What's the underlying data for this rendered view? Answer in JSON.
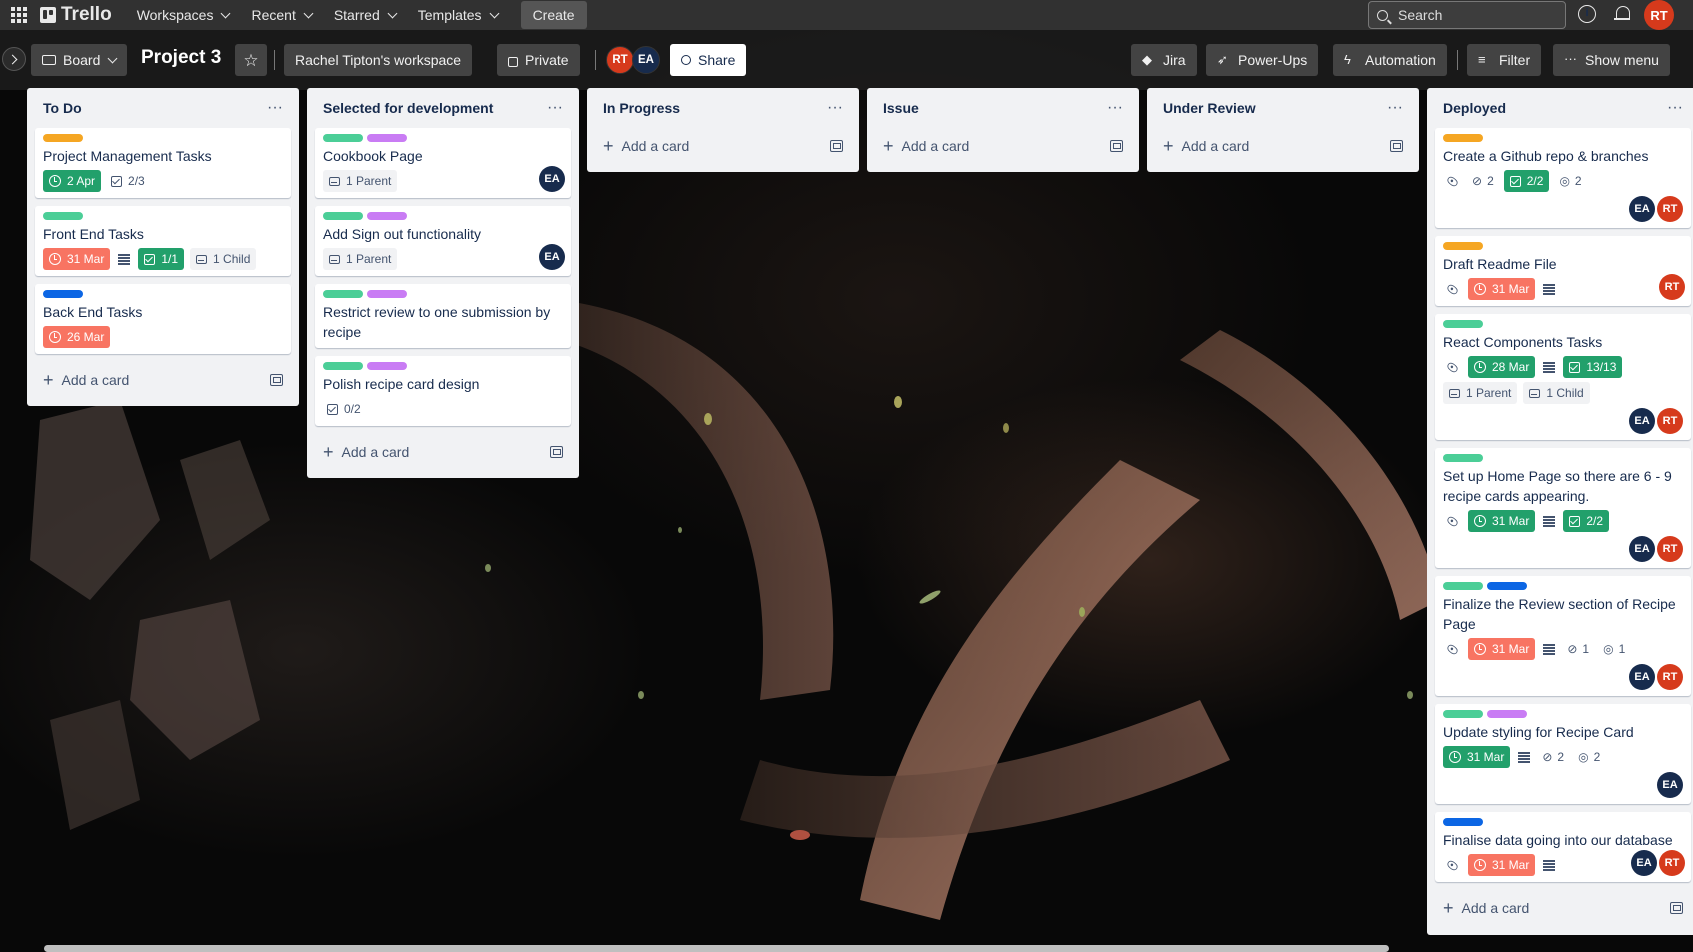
{
  "topnav": {
    "brand": "Trello",
    "menus": [
      "Workspaces",
      "Recent",
      "Starred",
      "Templates"
    ],
    "create_label": "Create",
    "search_placeholder": "Search",
    "user_initials": "RT"
  },
  "board": {
    "view_label": "Board",
    "title": "Project 3",
    "workspace_label": "Rachel Tipton's workspace",
    "visibility_label": "Private",
    "members": [
      "RT",
      "EA"
    ],
    "share_label": "Share",
    "jira_label": "Jira",
    "powerups_label": "Power-Ups",
    "automation_label": "Automation",
    "filter_label": "Filter",
    "show_menu_label": "Show menu"
  },
  "colors": {
    "orange": "#f5a623",
    "green": "#4bce97",
    "purple": "#c97cf4",
    "blue": "#0c66e4",
    "due_green": "#22a06b",
    "due_red": "#f87462",
    "avatar_rt": "#d63a1c",
    "avatar_ea": "#172b4d"
  },
  "add_card_label": "Add a card",
  "lists": [
    {
      "title": "To Do",
      "cards": [
        {
          "labels": [
            "orange"
          ],
          "title": "Project Management Tasks",
          "due": {
            "text": "2 Apr",
            "state": "green"
          },
          "checklist": {
            "text": "2/3",
            "state": "plain"
          }
        },
        {
          "labels": [
            "green"
          ],
          "title": "Front End Tasks",
          "due": {
            "text": "31 Mar",
            "state": "red"
          },
          "description": true,
          "checklist": {
            "text": "1/1",
            "state": "green"
          },
          "relation": "1 Child"
        },
        {
          "labels": [
            "blue"
          ],
          "title": "Back End Tasks",
          "due": {
            "text": "26 Mar",
            "state": "red"
          }
        }
      ]
    },
    {
      "title": "Selected for development",
      "cards": [
        {
          "labels": [
            "green",
            "purple"
          ],
          "title": "Cookbook Page",
          "relation": "1 Parent",
          "members": [
            "EA"
          ]
        },
        {
          "labels": [
            "green",
            "purple"
          ],
          "title": "Add Sign out functionality",
          "relation": "1 Parent",
          "members": [
            "EA"
          ]
        },
        {
          "labels": [
            "green",
            "purple"
          ],
          "title": "Restrict review to one submission by recipe"
        },
        {
          "labels": [
            "green",
            "purple"
          ],
          "title": "Polish recipe card design",
          "checklist": {
            "text": "0/2",
            "state": "plain"
          }
        }
      ]
    },
    {
      "title": "In Progress",
      "cards": []
    },
    {
      "title": "Issue",
      "cards": []
    },
    {
      "title": "Under Review",
      "cards": []
    },
    {
      "title": "Deployed",
      "cards": [
        {
          "labels": [
            "orange"
          ],
          "title": "Create a Github repo & branches",
          "watch": true,
          "attachments": "2",
          "checklist": {
            "text": "2/2",
            "state": "green"
          },
          "github": "2",
          "members": [
            "EA",
            "RT"
          ]
        },
        {
          "labels": [
            "orange"
          ],
          "title": "Draft Readme File",
          "watch": true,
          "due": {
            "text": "31 Mar",
            "state": "red"
          },
          "description": true,
          "members": [
            "RT"
          ]
        },
        {
          "labels": [
            "green"
          ],
          "title": "React Components Tasks",
          "watch": true,
          "due": {
            "text": "28 Mar",
            "state": "green"
          },
          "description": true,
          "checklist": {
            "text": "13/13",
            "state": "green"
          },
          "relation": "1 Parent",
          "relation2": "1 Child",
          "members": [
            "EA",
            "RT"
          ]
        },
        {
          "labels": [
            "green"
          ],
          "title": "Set up Home Page so there are 6 - 9 recipe cards appearing.",
          "watch": true,
          "due": {
            "text": "31 Mar",
            "state": "green"
          },
          "description": true,
          "checklist": {
            "text": "2/2",
            "state": "green"
          },
          "members": [
            "EA",
            "RT"
          ]
        },
        {
          "labels": [
            "green",
            "blue"
          ],
          "title": "Finalize the Review section of Recipe Page",
          "watch": true,
          "due": {
            "text": "31 Mar",
            "state": "red"
          },
          "description": true,
          "attachments": "1",
          "github": "1",
          "members": [
            "EA",
            "RT"
          ]
        },
        {
          "labels": [
            "green",
            "purple"
          ],
          "title": "Update styling for Recipe Card",
          "due": {
            "text": "31 Mar",
            "state": "green"
          },
          "description": true,
          "attachments": "2",
          "github": "2",
          "members": [
            "EA"
          ]
        },
        {
          "labels": [
            "blue"
          ],
          "title": "Finalise data going into our database",
          "watch": true,
          "due": {
            "text": "31 Mar",
            "state": "red"
          },
          "description": true,
          "members": [
            "EA",
            "RT"
          ]
        }
      ]
    }
  ]
}
